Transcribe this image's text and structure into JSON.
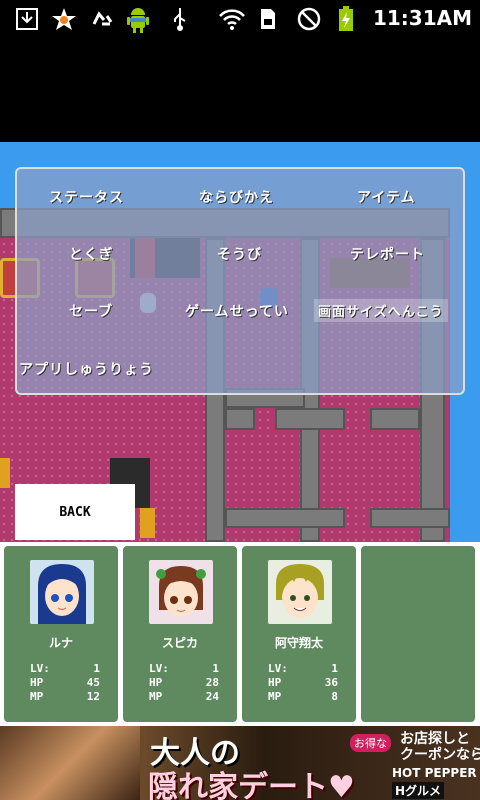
{
  "status_bar": {
    "time": "11:31AM",
    "icons": [
      "download-icon",
      "notification-star-icon",
      "recycle-icon",
      "android-icon",
      "usb-icon",
      "wifi-icon",
      "sdcard-icon",
      "no-sound-icon",
      "battery-charging-icon"
    ]
  },
  "menu": {
    "items": [
      {
        "label": "ステータス"
      },
      {
        "label": "ならびかえ"
      },
      {
        "label": "アイテム"
      },
      {
        "label": "とくぎ"
      },
      {
        "label": "そうび"
      },
      {
        "label": "テレポート"
      },
      {
        "label": "セーブ"
      },
      {
        "label": "ゲームせってい"
      },
      {
        "label": "画面サイズへんこう"
      },
      {
        "label": "アプリしゅうりょう"
      }
    ]
  },
  "back_button": {
    "label": "BACK"
  },
  "stat_labels": {
    "lv": "LV:",
    "hp": "HP",
    "mp": "MP"
  },
  "party": [
    {
      "name": "ルナ",
      "lv": "1",
      "hp": "45",
      "mp": "12",
      "hair_color": "#1a3a8f"
    },
    {
      "name": "スピカ",
      "lv": "1",
      "hp": "28",
      "mp": "24",
      "hair_color": "#7a3a20"
    },
    {
      "name": "阿守翔太",
      "lv": "1",
      "hp": "36",
      "mp": "8",
      "hair_color": "#a8a020"
    }
  ],
  "ad": {
    "headline": "大人の",
    "subline": "隠れ家デート♥",
    "pill": "お得な",
    "coupon_line1": "お店探しと",
    "coupon_line2": "クーポンなら",
    "brand": "HOT PEPPER",
    "brand2": "Hグルメ"
  }
}
